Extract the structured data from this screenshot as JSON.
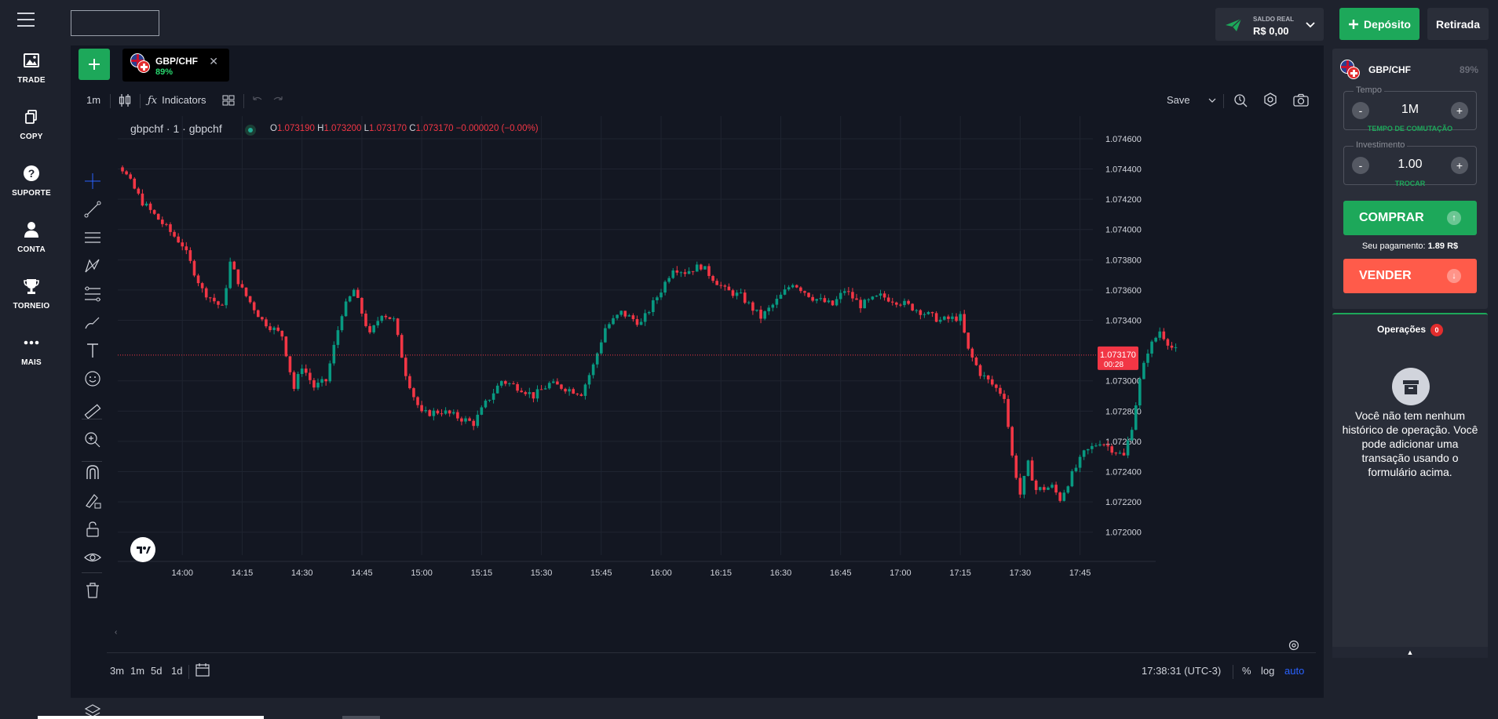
{
  "nav": {
    "items": [
      {
        "label": "TRADE",
        "icon": "image-icon"
      },
      {
        "label": "COPY",
        "icon": "copy-icon"
      },
      {
        "label": "SUPORTE",
        "icon": "help-icon"
      },
      {
        "label": "CONTA",
        "icon": "user-icon"
      },
      {
        "label": "TORNEIO",
        "icon": "trophy-icon"
      },
      {
        "label": "MAIS",
        "icon": "more-icon"
      }
    ]
  },
  "header": {
    "balance_label": "SALDO REAL",
    "balance_value": "R$ 0,00",
    "deposit_label": "Depósito",
    "withdraw_label": "Retirada"
  },
  "tab": {
    "symbol": "GBP/CHF",
    "payout": "89%"
  },
  "toolbar": {
    "interval": "1m",
    "indicators_label": "Indicators",
    "save_label": "Save"
  },
  "chart_legend": {
    "title": "gbpchf · 1 · gbpchf",
    "open_label": "O",
    "open": "1.073190",
    "high_label": "H",
    "high": "1.073200",
    "low_label": "L",
    "low": "1.073170",
    "close_label": "C",
    "close": "1.073170",
    "change": "−0.000020 (−0.00%)"
  },
  "chart_data": {
    "type": "candlestick",
    "symbol": "gbpchf",
    "x_ticks": [
      "14:00",
      "14:15",
      "14:30",
      "14:45",
      "15:00",
      "15:15",
      "15:30",
      "15:45",
      "16:00",
      "16:15",
      "16:30",
      "16:45",
      "17:00",
      "17:15",
      "17:30",
      "17:45"
    ],
    "y_ticks": [
      "1.074600",
      "1.074400",
      "1.074200",
      "1.074000",
      "1.073800",
      "1.073600",
      "1.073400",
      "1.073000",
      "1.072800",
      "1.072600",
      "1.072400",
      "1.072200",
      "1.072000"
    ],
    "ylim": [
      1.0719,
      1.07475
    ],
    "xlim_minutes": [
      825,
      1070
    ],
    "current_price": "1.073170",
    "countdown": "00:28",
    "colors": {
      "up": "#089981",
      "down": "#f23645"
    },
    "path_close": [
      [
        815,
        1.0741
      ],
      [
        820,
        1.07455
      ],
      [
        825,
        1.0744
      ],
      [
        830,
        1.07418
      ],
      [
        835,
        1.07404
      ],
      [
        840,
        1.0739
      ],
      [
        845,
        1.0736
      ],
      [
        850,
        1.07348
      ],
      [
        852,
        1.07378
      ],
      [
        855,
        1.0736
      ],
      [
        860,
        1.0734
      ],
      [
        865,
        1.0733
      ],
      [
        868,
        1.07295
      ],
      [
        870,
        1.0731
      ],
      [
        873,
        1.07296
      ],
      [
        876,
        1.073
      ],
      [
        880,
        1.07345
      ],
      [
        883,
        1.0736
      ],
      [
        887,
        1.0733
      ],
      [
        890,
        1.07345
      ],
      [
        893,
        1.0734
      ],
      [
        896,
        1.07305
      ],
      [
        898,
        1.0729
      ],
      [
        900,
        1.07278
      ],
      [
        905,
        1.0728
      ],
      [
        910,
        1.07275
      ],
      [
        913,
        1.07272
      ],
      [
        916,
        1.07285
      ],
      [
        920,
        1.073
      ],
      [
        925,
        1.07295
      ],
      [
        928,
        1.0729
      ],
      [
        932,
        1.07298
      ],
      [
        935,
        1.07296
      ],
      [
        940,
        1.07292
      ],
      [
        943,
        1.0731
      ],
      [
        946,
        1.07335
      ],
      [
        950,
        1.07345
      ],
      [
        955,
        1.07338
      ],
      [
        960,
        1.0736
      ],
      [
        963,
        1.07375
      ],
      [
        966,
        1.07372
      ],
      [
        970,
        1.07376
      ],
      [
        973,
        1.07368
      ],
      [
        976,
        1.0736
      ],
      [
        980,
        1.07356
      ],
      [
        985,
        1.07342
      ],
      [
        988,
        1.0735
      ],
      [
        993,
        1.07365
      ],
      [
        998,
        1.07355
      ],
      [
        1003,
        1.0735
      ],
      [
        1006,
        1.0736
      ],
      [
        1010,
        1.0735
      ],
      [
        1015,
        1.07356
      ],
      [
        1020,
        1.07352
      ],
      [
        1025,
        1.07346
      ],
      [
        1030,
        1.0734
      ],
      [
        1035,
        1.07342
      ],
      [
        1037,
        1.0732
      ],
      [
        1040,
        1.07305
      ],
      [
        1042,
        1.073
      ],
      [
        1046,
        1.0729
      ],
      [
        1048,
        1.0725
      ],
      [
        1050,
        1.07225
      ],
      [
        1052,
        1.07245
      ],
      [
        1054,
        1.07228
      ],
      [
        1058,
        1.0723
      ],
      [
        1060,
        1.07222
      ],
      [
        1063,
        1.07238
      ],
      [
        1066,
        1.07252
      ],
      [
        1070,
        1.0726
      ],
      [
        1073,
        1.07255
      ],
      [
        1076,
        1.0725
      ],
      [
        1078,
        1.0727
      ],
      [
        1080,
        1.073
      ],
      [
        1082,
        1.0732
      ],
      [
        1085,
        1.07333
      ],
      [
        1088,
        1.07322
      ],
      [
        1090,
        1.07318
      ]
    ]
  },
  "bottom_toolbar": {
    "ranges": [
      "3m",
      "1m",
      "5d",
      "1d"
    ],
    "clock": "17:38:31 (UTC-3)",
    "percent": "%",
    "log": "log",
    "auto": "auto"
  },
  "trade_panel": {
    "symbol": "GBP/CHF",
    "payout": "89%",
    "time_label": "Tempo",
    "time_value": "1M",
    "time_hint": "TEMPO DE COMUTAÇÃO",
    "investment_label": "Investimento",
    "investment_value": "1.00",
    "investment_hint": "TROCAR",
    "buy_label": "COMPRAR",
    "payout_text": "Seu pagamento:",
    "payout_value": "1.89 R$",
    "sell_label": "VENDER",
    "minus": "-",
    "plus": "+"
  },
  "operations": {
    "title": "Operações",
    "count": "0",
    "empty_message": "Você não tem nenhum histórico de operação. Você pode adicionar uma transação usando o formulário acima."
  }
}
